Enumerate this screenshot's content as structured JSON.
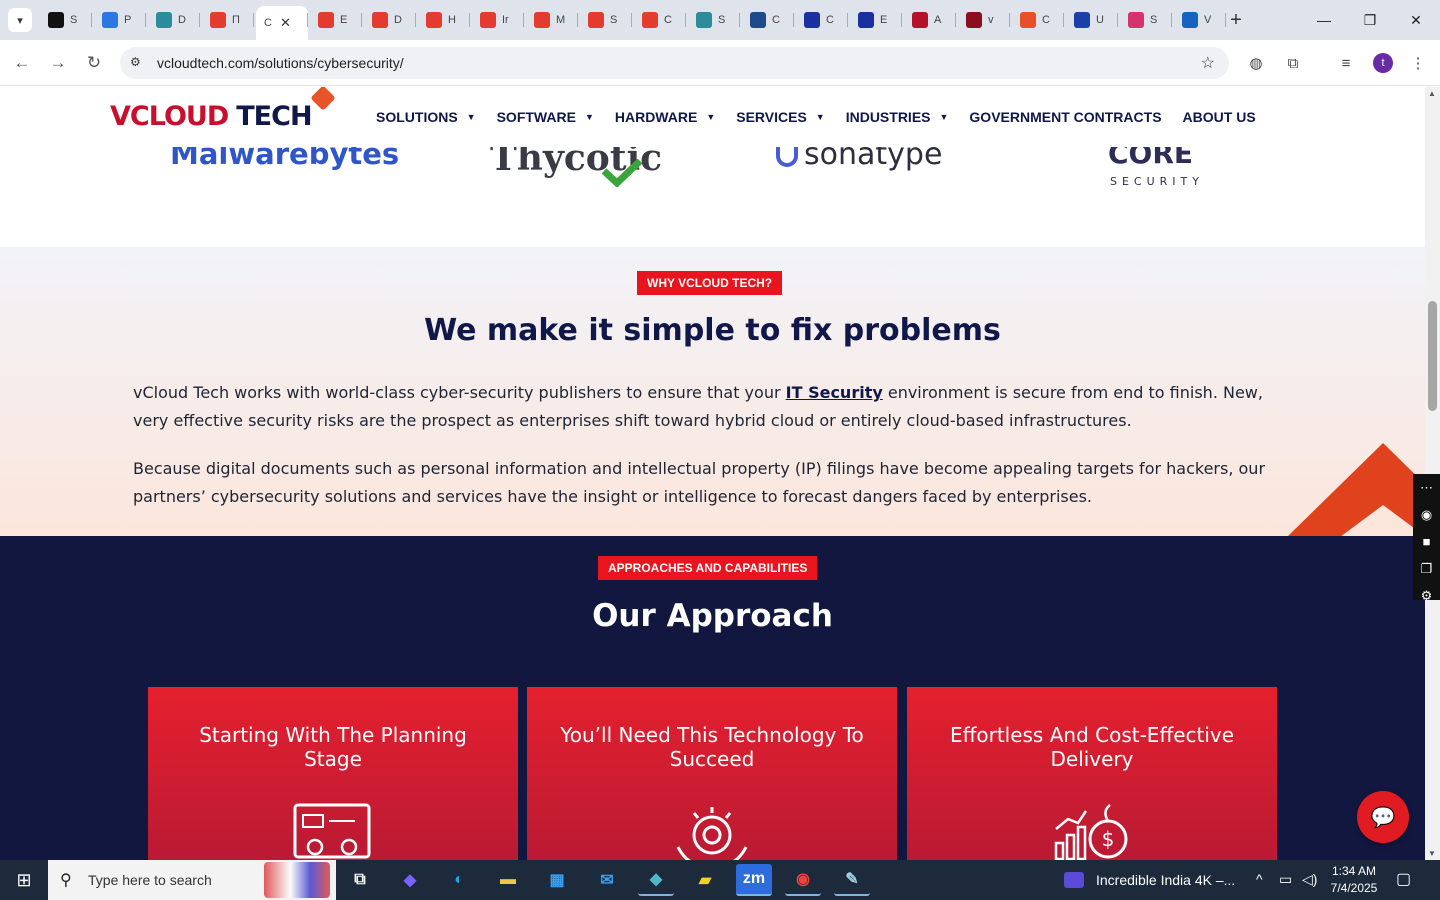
{
  "browser": {
    "tabs": [
      {
        "label": "S",
        "icon": "github-icon",
        "color": "#111111"
      },
      {
        "label": "P",
        "icon": "speed-icon",
        "color": "#2b78e4"
      },
      {
        "label": "D",
        "icon": "teal-icon",
        "color": "#2b8c9c"
      },
      {
        "label": "П",
        "icon": "red-tag-icon",
        "color": "#e33b2e"
      },
      {
        "label": "C",
        "active": true,
        "icon": "none"
      },
      {
        "label": "E",
        "icon": "red-tag-icon",
        "color": "#e33b2e"
      },
      {
        "label": "D",
        "icon": "red-tag-icon",
        "color": "#e33b2e"
      },
      {
        "label": "H",
        "icon": "red-tag-icon",
        "color": "#e33b2e"
      },
      {
        "label": "Ir",
        "icon": "red-tag-icon",
        "color": "#e33b2e"
      },
      {
        "label": "M",
        "icon": "red-tag-icon",
        "color": "#e33b2e"
      },
      {
        "label": "S",
        "icon": "red-tag-icon",
        "color": "#e33b2e"
      },
      {
        "label": "C",
        "icon": "red-tag-icon",
        "color": "#e33b2e"
      },
      {
        "label": "S",
        "icon": "teal-icon",
        "color": "#2b8c9c"
      },
      {
        "label": "C",
        "icon": "scales-icon",
        "color": "#1e4a8c"
      },
      {
        "label": "C",
        "icon": "x-icon",
        "color": "#1a2fa0"
      },
      {
        "label": "E",
        "icon": "check-pen-icon",
        "color": "#1a2fa0"
      },
      {
        "label": "A",
        "icon": "red-dots-icon",
        "color": "#b3122a"
      },
      {
        "label": "v",
        "icon": "v-icon",
        "color": "#8c0f1f"
      },
      {
        "label": "C",
        "icon": "slash-icon",
        "color": "#e8502a"
      },
      {
        "label": "U",
        "icon": "doc-icon",
        "color": "#1a3fa8"
      },
      {
        "label": "S",
        "icon": "spark-icon",
        "color": "#d6336c"
      },
      {
        "label": "V",
        "icon": "wave-icon",
        "color": "#1565c0"
      }
    ],
    "url": "vcloudtech.com/solutions/cybersecurity/",
    "profile_initial": "t"
  },
  "site": {
    "logo": {
      "v": "V",
      "cloud": "CLOUD",
      "tech": "TECH"
    },
    "menu": [
      {
        "label": "SOLUTIONS",
        "dropdown": true
      },
      {
        "label": "SOFTWARE",
        "dropdown": true
      },
      {
        "label": "HARDWARE",
        "dropdown": true
      },
      {
        "label": "SERVICES",
        "dropdown": true
      },
      {
        "label": "INDUSTRIES",
        "dropdown": true
      },
      {
        "label": "GOVERNMENT CONTRACTS",
        "dropdown": false
      },
      {
        "label": "ABOUT US",
        "dropdown": false
      }
    ],
    "partners": {
      "malwarebytes": "Malwarebytes",
      "thycotic": "Thycotic",
      "sonatype": "sonatype",
      "core": "CORE",
      "core_sub": "SECURITY"
    },
    "why": {
      "tag": "WHY VCLOUD TECH?",
      "title": "We make it simple to fix problems",
      "p1_before": "vCloud Tech works with world-class cyber-security publishers to ensure that your ",
      "p1_link": "IT Security",
      "p1_after": " environment is secure from end to finish. New, very effective security risks are the prospect as enterprises shift toward hybrid cloud or entirely cloud-based infrastructures.",
      "p2": "Because digital documents such as personal information and intellectual property (IP) filings have become appealing targets for hackers, our partners’ cybersecurity solutions and services have the insight or intelligence to forecast dangers faced by enterprises."
    },
    "approach": {
      "tag": "APPROACHES AND CAPABILITIES",
      "title": "Our Approach",
      "cards": [
        {
          "title": "Starting With The Planning Stage",
          "icon": "planning-board-icon"
        },
        {
          "title": "You’ll Need This Technology To Succeed",
          "icon": "gear-hands-icon"
        },
        {
          "title": "Effortless And Cost-Effective Delivery",
          "icon": "money-growth-icon"
        }
      ]
    }
  },
  "taskbar": {
    "search_placeholder": "Type here to search",
    "media_title": "Incredible India 4K –...",
    "time": "1:34 AM",
    "date": "7/4/2025"
  }
}
